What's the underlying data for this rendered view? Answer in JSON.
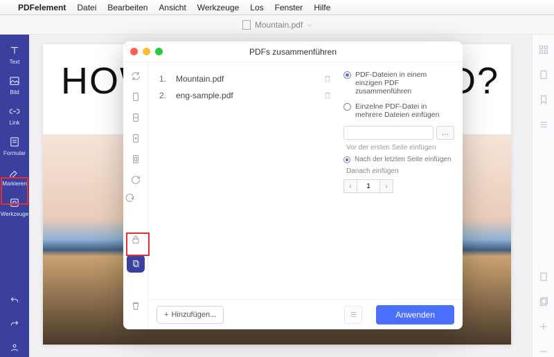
{
  "menubar": {
    "app": "PDFelement",
    "items": [
      "Datei",
      "Bearbeiten",
      "Ansicht",
      "Werkzeuge",
      "Los",
      "Fenster",
      "Hilfe"
    ]
  },
  "titlebar": {
    "doc": "Mountain.pdf"
  },
  "left_rail": {
    "items": [
      {
        "label": "Text",
        "icon": "text"
      },
      {
        "label": "Bild",
        "icon": "image"
      },
      {
        "label": "Link",
        "icon": "link"
      },
      {
        "label": "Formular",
        "icon": "form"
      },
      {
        "label": "Markieren",
        "icon": "highlight"
      },
      {
        "label": "Werkzeuge",
        "icon": "tools",
        "highlighted": true
      }
    ],
    "bottom": [
      {
        "icon": "undo"
      },
      {
        "icon": "redo"
      },
      {
        "icon": "user"
      }
    ]
  },
  "doc_bg": {
    "headline_start": "HOW",
    "headline_end": "D?"
  },
  "modal": {
    "title": "PDFs zusammenführen",
    "files": [
      {
        "idx": "1.",
        "name": "Mountain.pdf"
      },
      {
        "idx": "2.",
        "name": "eng-sample.pdf"
      }
    ],
    "side_icons": [
      "refresh",
      "page",
      "page",
      "page",
      "page",
      "rotate",
      "rotate",
      "lock",
      "merge",
      "trash"
    ],
    "active_side_idx": 8,
    "options": {
      "opt1": "PDF-Dateien in einem einzigen PDF zusammenführen",
      "opt2": "Einzelne PDF-Datei in mehrere Dateien einfügen",
      "browse": "…",
      "before": "Vor der ersten Seite einfügen",
      "after": "Nach der letzten Seite einfügen",
      "then": "Danach einfügen",
      "page_value": "1"
    },
    "add_btn": "Hinzufügen...",
    "apply": "Anwenden"
  }
}
